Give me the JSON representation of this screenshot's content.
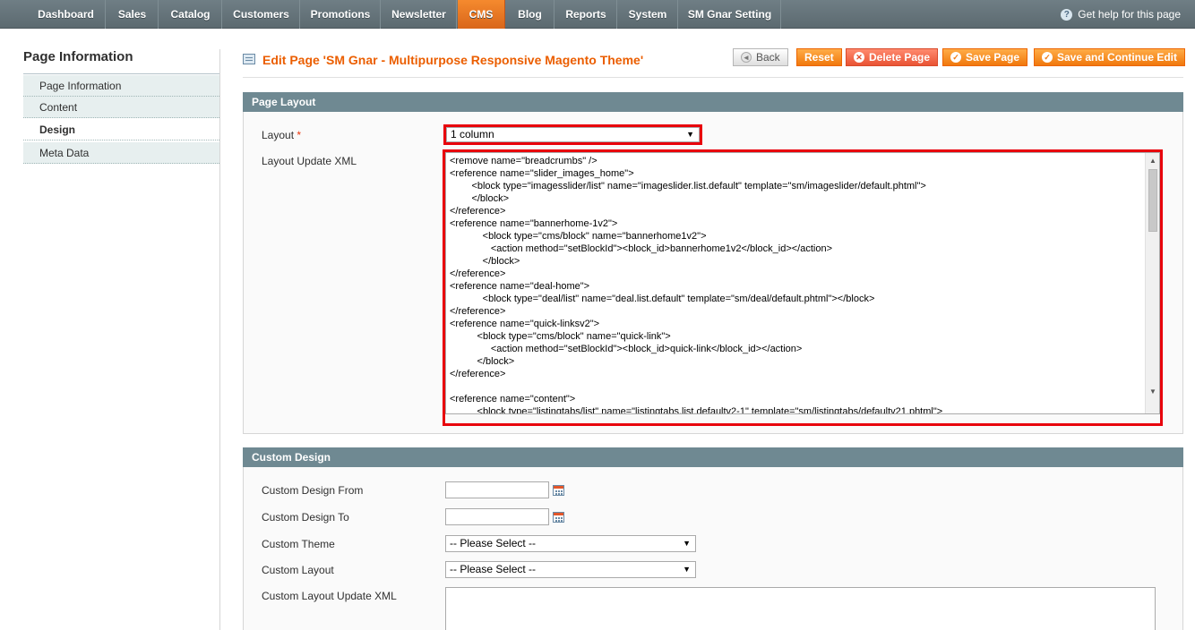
{
  "nav": {
    "items": [
      {
        "label": "Dashboard"
      },
      {
        "label": "Sales"
      },
      {
        "label": "Catalog"
      },
      {
        "label": "Customers"
      },
      {
        "label": "Promotions"
      },
      {
        "label": "Newsletter"
      },
      {
        "label": "CMS",
        "active": true
      },
      {
        "label": "Blog"
      },
      {
        "label": "Reports"
      },
      {
        "label": "System"
      },
      {
        "label": "SM Gnar Setting"
      }
    ],
    "help_label": "Get help for this page",
    "help_icon": "question-circle-icon"
  },
  "sidebar": {
    "title": "Page Information",
    "items": [
      {
        "label": "Page Information"
      },
      {
        "label": "Content"
      },
      {
        "label": "Design",
        "active": true
      },
      {
        "label": "Meta Data"
      }
    ]
  },
  "header": {
    "title": "Edit Page 'SM Gnar - Multipurpose Responsive Magento Theme'",
    "icon": "page-edit-icon",
    "buttons": {
      "back": "Back",
      "reset": "Reset",
      "delete": "Delete Page",
      "save": "Save Page",
      "save_continue": "Save and Continue Edit"
    }
  },
  "page_layout": {
    "heading": "Page Layout",
    "layout_label": "Layout",
    "required_mark": "*",
    "layout_value": "1 column",
    "xml_label": "Layout Update XML",
    "xml_lines": [
      "<remove name=\"breadcrumbs\" />",
      "<reference name=\"slider_images_home\">",
      "        <block type=\"imagesslider/list\" name=\"imageslider.list.default\" template=\"sm/imageslider/default.phtml\">",
      "        </block>",
      "</reference>",
      "<reference name=\"bannerhome-1v2\">",
      "            <block type=\"cms/block\" name=\"bannerhome1v2\">",
      "               <action method=\"setBlockId\"><block_id>bannerhome1v2</block_id></action>",
      "            </block>",
      "</reference>",
      "<reference name=\"deal-home\">",
      "            <block type=\"deal/list\" name=\"deal.list.default\" template=\"sm/deal/default.phtml\"></block>",
      "</reference>",
      "<reference name=\"quick-linksv2\">",
      "          <block type=\"cms/block\" name=\"quick-link\">",
      "               <action method=\"setBlockId\"><block_id>quick-link</block_id></action>",
      "          </block>",
      "</reference>",
      "",
      "<reference name=\"content\">",
      "          <block type=\"listingtabs/list\" name=\"listingtabs.list.defaultv2-1\" template=\"sm/listingtabs/defaultv21.phtml\">"
    ]
  },
  "custom_design": {
    "heading": "Custom Design",
    "from_label": "Custom Design From",
    "to_label": "Custom Design To",
    "theme_label": "Custom Theme",
    "theme_value": "-- Please Select --",
    "layout_label": "Custom Layout",
    "layout_value": "-- Please Select --",
    "xml_label": "Custom Layout Update XML",
    "calendar_icon": "calendar-icon"
  },
  "colors": {
    "accent": "#eb5e00",
    "active_tab": "#f0780c",
    "highlight": "#e8000b",
    "section_header": "#6f8992"
  }
}
